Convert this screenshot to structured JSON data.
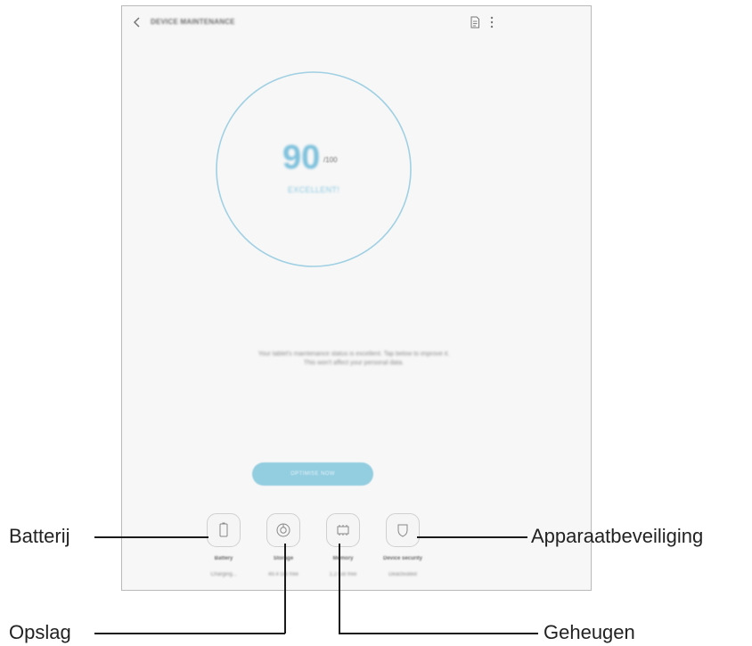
{
  "header": {
    "title": "DEVICE MAINTENANCE"
  },
  "score": {
    "value": "90",
    "max": "/100",
    "status": "EXCELLENT!"
  },
  "description": {
    "line1": "Your tablet's maintenance status is excellent. Tap below to improve it.",
    "line2": "This won't affect your personal data."
  },
  "optimize_button": {
    "label": "OPTIMISE NOW"
  },
  "tiles": [
    {
      "label": "Battery",
      "sub": "Charging...",
      "icon": "battery-icon"
    },
    {
      "label": "Storage",
      "sub": "49.4 GB free",
      "icon": "storage-icon"
    },
    {
      "label": "Memory",
      "sub": "1.2 GB free",
      "icon": "memory-icon"
    },
    {
      "label": "Device security",
      "sub": "Deactivated",
      "icon": "shield-icon"
    }
  ],
  "callouts": {
    "batterij": "Batterij",
    "opslag": "Opslag",
    "geheugen": "Geheugen",
    "apparaatbeveiliging": "Apparaatbeveiliging"
  },
  "colors": {
    "accent": "#7ec1dc",
    "ring": "#9fd0e3",
    "button": "#92cde0"
  }
}
